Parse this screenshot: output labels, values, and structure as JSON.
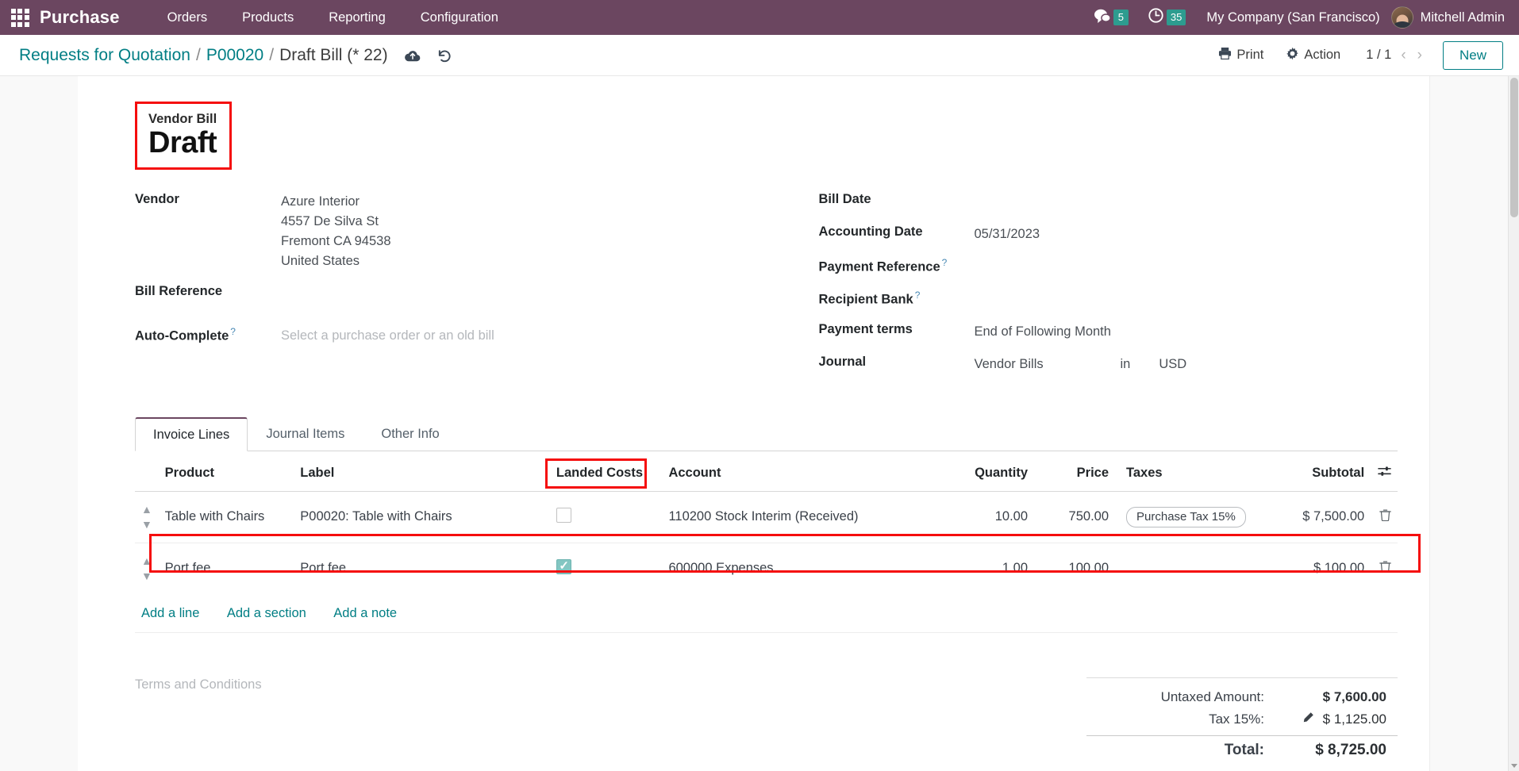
{
  "navbar": {
    "apps_icon": "apps-grid-icon",
    "brand": "Purchase",
    "menu": [
      {
        "label": "Orders"
      },
      {
        "label": "Products"
      },
      {
        "label": "Reporting"
      },
      {
        "label": "Configuration"
      }
    ],
    "messages_icon": "chat-bubble-icon",
    "messages_count": "5",
    "activities_icon": "clock-icon",
    "activities_count": "35",
    "company": "My Company (San Francisco)",
    "user": "Mitchell Admin",
    "badge_color": "#2d9c8f",
    "bar_color": "#6b4660"
  },
  "control_panel": {
    "breadcrumb": {
      "root": "Requests for Quotation",
      "parent": "P00020",
      "current": "Draft Bill (* 22)",
      "separator": "/"
    },
    "save_icon": "cloud-upload-icon",
    "discard_icon": "undo-icon",
    "print_label": "Print",
    "print_icon": "printer-icon",
    "action_label": "Action",
    "action_icon": "gear-icon",
    "pager": "1 / 1",
    "prev_icon": "chevron-left-icon",
    "next_icon": "chevron-right-icon",
    "new_label": "New",
    "accent_color": "#017e84"
  },
  "status": {
    "label": "Vendor Bill",
    "value": "Draft",
    "highlight_color": "#f50d0d"
  },
  "form": {
    "left": {
      "vendor_label": "Vendor",
      "vendor_name": "Azure Interior",
      "vendor_street": "4557 De Silva St",
      "vendor_city": "Fremont CA 94538",
      "vendor_country": "United States",
      "bill_reference_label": "Bill Reference",
      "bill_reference_value": "",
      "autocomplete_label": "Auto-Complete",
      "autocomplete_help": "?",
      "autocomplete_placeholder": "Select a purchase order or an old bill"
    },
    "right": {
      "bill_date_label": "Bill Date",
      "bill_date_value": "",
      "accounting_date_label": "Accounting Date",
      "accounting_date_value": "05/31/2023",
      "payment_reference_label": "Payment Reference",
      "payment_reference_help": "?",
      "payment_reference_value": "",
      "recipient_bank_label": "Recipient Bank",
      "recipient_bank_help": "?",
      "recipient_bank_value": "",
      "payment_terms_label": "Payment terms",
      "payment_terms_value": "End of Following Month",
      "journal_label": "Journal",
      "journal_value": "Vendor Bills",
      "journal_in": "in",
      "journal_currency": "USD"
    }
  },
  "notebook": {
    "tabs": [
      {
        "label": "Invoice Lines",
        "active": true
      },
      {
        "label": "Journal Items",
        "active": false
      },
      {
        "label": "Other Info",
        "active": false
      }
    ]
  },
  "lines_table": {
    "columns": {
      "product": "Product",
      "label": "Label",
      "landed_costs": "Landed Costs",
      "account": "Account",
      "quantity": "Quantity",
      "price": "Price",
      "taxes": "Taxes",
      "subtotal": "Subtotal",
      "options_icon": "column-options-icon"
    },
    "rows": [
      {
        "handle_icon": "drag-handle-icon",
        "product": "Table with Chairs",
        "label": "P00020: Table with Chairs",
        "landed_costs_checked": false,
        "account": "110200 Stock Interim (Received)",
        "quantity": "10.00",
        "price": "750.00",
        "tax": "Purchase Tax 15%",
        "subtotal": "$ 7,500.00",
        "delete_icon": "trash-icon",
        "highlighted": false
      },
      {
        "handle_icon": "drag-handle-icon",
        "product": "Port fee",
        "label": "Port fee",
        "landed_costs_checked": true,
        "account": "600000 Expenses",
        "quantity": "1.00",
        "price": "100.00",
        "tax": "",
        "subtotal": "$ 100.00",
        "delete_icon": "trash-icon",
        "highlighted": true
      }
    ],
    "add_line": "Add a line",
    "add_section": "Add a section",
    "add_note": "Add a note"
  },
  "footer": {
    "terms_placeholder": "Terms and Conditions",
    "totals": [
      {
        "label": "Untaxed Amount:",
        "value": "$ 7,600.00",
        "bold": true,
        "editable": false
      },
      {
        "label": "Tax 15%:",
        "value": "$ 1,125.00",
        "bold": false,
        "editable": true
      },
      {
        "label": "Total:",
        "value": "$ 8,725.00",
        "bold": true,
        "editable": false
      }
    ],
    "edit_icon": "pencil-icon"
  }
}
